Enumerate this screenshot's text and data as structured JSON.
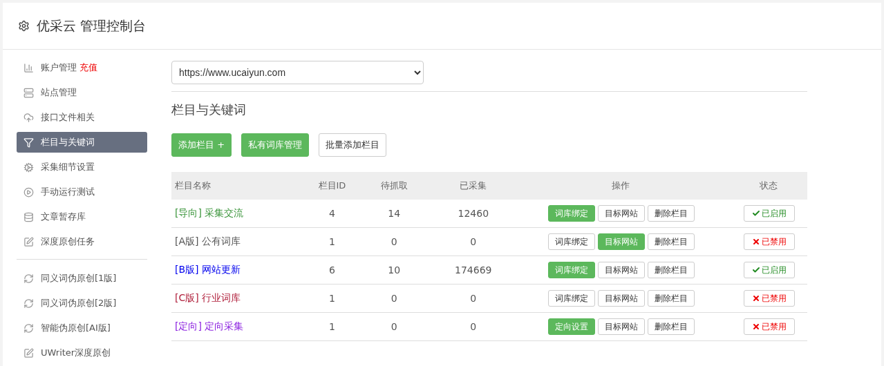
{
  "header": {
    "title": "优采云 管理控制台"
  },
  "sidebar": {
    "items": [
      {
        "label": "账户管理",
        "badge": "充值",
        "selected": false
      },
      {
        "label": "站点管理",
        "selected": false
      },
      {
        "label": "接口文件相关",
        "selected": false
      },
      {
        "label": "栏目与关键词",
        "selected": true
      },
      {
        "label": "采集细节设置",
        "selected": false
      },
      {
        "label": "手动运行测试",
        "selected": false
      },
      {
        "label": "文章暂存库",
        "selected": false
      },
      {
        "label": "深度原创任务",
        "selected": false
      }
    ],
    "tools": [
      {
        "label": "同义词伪原创[1版]"
      },
      {
        "label": "同义词伪原创[2版]"
      },
      {
        "label": "智能伪原创[AI版]"
      },
      {
        "label": "UWriter深度原创"
      }
    ]
  },
  "site_select": {
    "value": "https://www.ucaiyun.com"
  },
  "section_title": "栏目与关键词",
  "actions": [
    {
      "label": "添加栏目 +",
      "primary": true
    },
    {
      "label": "私有词库管理",
      "primary": true
    },
    {
      "label": "批量添加栏目",
      "primary": false
    }
  ],
  "table": {
    "columns": [
      "栏目名称",
      "栏目ID",
      "待抓取",
      "已采集",
      "操作",
      "状态"
    ],
    "rows": [
      {
        "name": "[导向] 采集交流",
        "color": "#3c963c",
        "id": "4",
        "pending": "14",
        "collected": "12460",
        "buttons": [
          {
            "label": "词库绑定",
            "primary": true
          },
          {
            "label": "目标网站",
            "primary": false
          },
          {
            "label": "删除栏目",
            "primary": false
          }
        ],
        "status": "已启用",
        "enabled": true
      },
      {
        "name": "[A版] 公有词库",
        "color": "#555555",
        "id": "1",
        "pending": "0",
        "collected": "0",
        "buttons": [
          {
            "label": "词库绑定",
            "primary": false
          },
          {
            "label": "目标网站",
            "primary": true
          },
          {
            "label": "删除栏目",
            "primary": false
          }
        ],
        "status": "已禁用",
        "enabled": false
      },
      {
        "name": "[B版] 网站更新",
        "color": "#0000ee",
        "id": "6",
        "pending": "10",
        "collected": "174669",
        "buttons": [
          {
            "label": "词库绑定",
            "primary": true
          },
          {
            "label": "目标网站",
            "primary": false
          },
          {
            "label": "删除栏目",
            "primary": false
          }
        ],
        "status": "已启用",
        "enabled": true
      },
      {
        "name": "[C版] 行业词库",
        "color": "#b0203c",
        "id": "1",
        "pending": "0",
        "collected": "0",
        "buttons": [
          {
            "label": "词库绑定",
            "primary": false
          },
          {
            "label": "目标网站",
            "primary": false
          },
          {
            "label": "删除栏目",
            "primary": false
          }
        ],
        "status": "已禁用",
        "enabled": false
      },
      {
        "name": "[定向] 定向采集",
        "color": "#8a1ee0",
        "id": "1",
        "pending": "0",
        "collected": "0",
        "buttons": [
          {
            "label": "定向设置",
            "primary": true
          },
          {
            "label": "目标网站",
            "primary": false
          },
          {
            "label": "删除栏目",
            "primary": false
          }
        ],
        "status": "已禁用",
        "enabled": false
      }
    ]
  }
}
